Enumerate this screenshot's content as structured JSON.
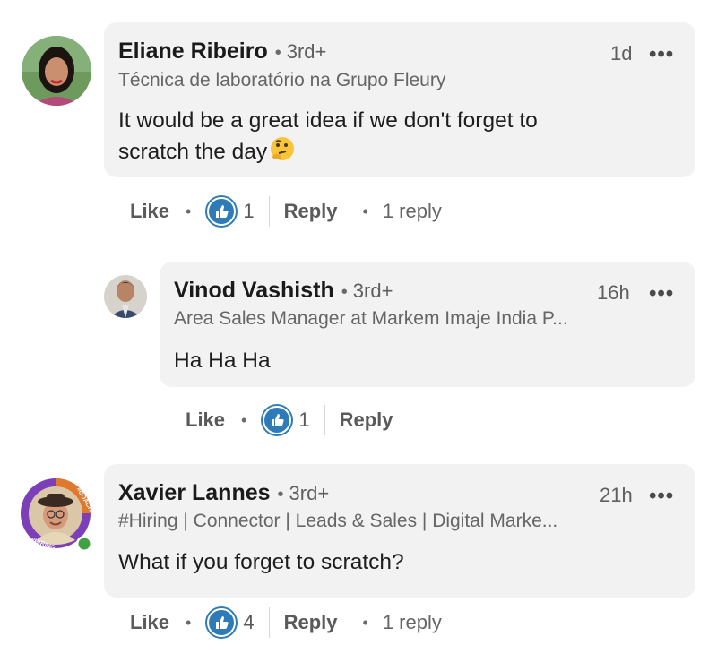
{
  "comments": [
    {
      "name": "Eliane Ribeiro",
      "degree": "3rd+",
      "time": "1d",
      "headline": "Técnica de laboratório na Grupo Fleury",
      "text_line1": "It would be a great idea if we don't forget to",
      "text_line2": "scratch the day",
      "emoji": "🤔",
      "like_label": "Like",
      "reaction_count": "1",
      "reply_label": "Reply",
      "replies": "1 reply"
    },
    {
      "name": "Vinod Vashisth",
      "degree": "3rd+",
      "time": "16h",
      "headline": "Area Sales Manager at Markem Imaje India P...",
      "text_line1": "Ha Ha Ha",
      "like_label": "Like",
      "reaction_count": "1",
      "reply_label": "Reply"
    },
    {
      "name": "Xavier Lannes",
      "degree": "3rd+",
      "time": "21h",
      "headline": "#Hiring | Connector | Leads & Sales | Digital Marke...",
      "text_line1": "What if you forget to scratch?",
      "avatar_frame_text": "#HIRING",
      "avatar_frame_text2": "#COACH",
      "like_label": "Like",
      "reaction_count": "4",
      "reply_label": "Reply",
      "replies": "1 reply"
    }
  ],
  "more_glyph": "•••",
  "dot_glyph": "•",
  "colors": {
    "bubble": "#f2f2f2",
    "like_blue": "#2e7bb8",
    "hiring_purple": "#7d3fb8",
    "online_green": "#3fa142"
  }
}
